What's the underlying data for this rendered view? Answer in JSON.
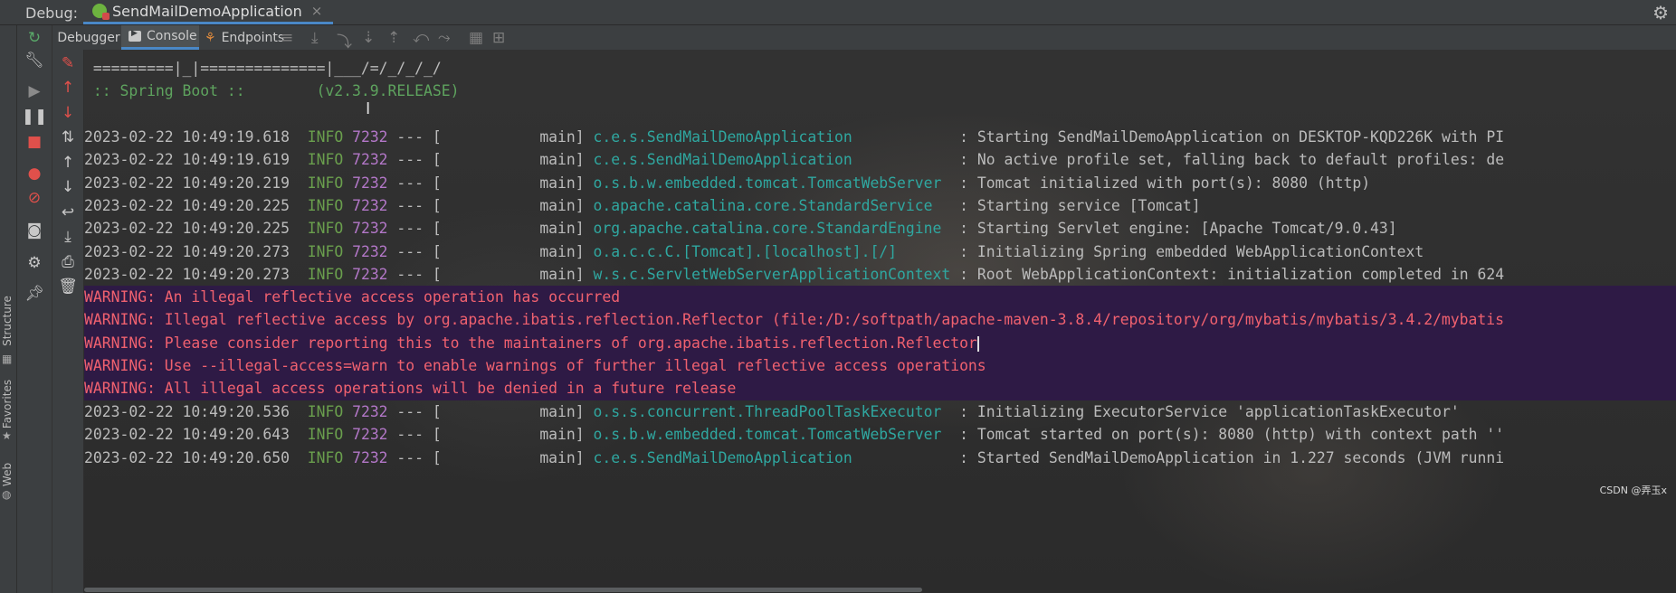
{
  "titlebar": {
    "label": "Debug:",
    "run_config": "SendMailDemoApplication",
    "close": "×"
  },
  "tabs": {
    "debugger": "Debugger",
    "console": "Console",
    "endpoints": "Endpoints"
  },
  "left_strip": {
    "structure": "Structure",
    "favorites": "Favorites",
    "web": "Web"
  },
  "console": {
    "banner_line1": " =========|_|==============|___/=/_/_/_/",
    "banner_line2": " :: Spring Boot ::        (v2.3.9.RELEASE)",
    "logs_top": [
      {
        "ts": "2023-02-22 10:49:19.618",
        "level": "INFO",
        "pid": "7232",
        "sep": " --- [           main] ",
        "logger": "c.e.s.SendMailDemoApplication           ",
        "msg": " : Starting SendMailDemoApplication on DESKTOP-KQD226K with PI"
      },
      {
        "ts": "2023-02-22 10:49:19.619",
        "level": "INFO",
        "pid": "7232",
        "sep": " --- [           main] ",
        "logger": "c.e.s.SendMailDemoApplication           ",
        "msg": " : No active profile set, falling back to default profiles: de"
      },
      {
        "ts": "2023-02-22 10:49:20.219",
        "level": "INFO",
        "pid": "7232",
        "sep": " --- [           main] ",
        "logger": "o.s.b.w.embedded.tomcat.TomcatWebServer ",
        "msg": " : Tomcat initialized with port(s): 8080 (http)"
      },
      {
        "ts": "2023-02-22 10:49:20.225",
        "level": "INFO",
        "pid": "7232",
        "sep": " --- [           main] ",
        "logger": "o.apache.catalina.core.StandardService  ",
        "msg": " : Starting service [Tomcat]"
      },
      {
        "ts": "2023-02-22 10:49:20.225",
        "level": "INFO",
        "pid": "7232",
        "sep": " --- [           main] ",
        "logger": "org.apache.catalina.core.StandardEngine ",
        "msg": " : Starting Servlet engine: [Apache Tomcat/9.0.43]"
      },
      {
        "ts": "2023-02-22 10:49:20.273",
        "level": "INFO",
        "pid": "7232",
        "sep": " --- [           main] ",
        "logger": "o.a.c.c.C.[Tomcat].[localhost].[/]      ",
        "msg": " : Initializing Spring embedded WebApplicationContext"
      },
      {
        "ts": "2023-02-22 10:49:20.273",
        "level": "INFO",
        "pid": "7232",
        "sep": " --- [           main] ",
        "logger": "w.s.c.ServletWebServerApplicationContext",
        "msg": " : Root WebApplicationContext: initialization completed in 624"
      }
    ],
    "warnings": [
      "WARNING: An illegal reflective access operation has occurred",
      "WARNING: Illegal reflective access by org.apache.ibatis.reflection.Reflector (file:/D:/softpath/apache-maven-3.8.4/repository/org/mybatis/mybatis/3.4.2/mybatis",
      "WARNING: Please consider reporting this to the maintainers of org.apache.ibatis.reflection.Reflector",
      "WARNING: Use --illegal-access=warn to enable warnings of further illegal reflective access operations",
      "WARNING: All illegal access operations will be denied in a future release"
    ],
    "logs_bottom": [
      {
        "ts": "2023-02-22 10:49:20.536",
        "level": "INFO",
        "pid": "7232",
        "sep": " --- [           main] ",
        "logger": "o.s.s.concurrent.ThreadPoolTaskExecutor ",
        "msg": " : Initializing ExecutorService 'applicationTaskExecutor'"
      },
      {
        "ts": "2023-02-22 10:49:20.643",
        "level": "INFO",
        "pid": "7232",
        "sep": " --- [           main] ",
        "logger": "o.s.b.w.embedded.tomcat.TomcatWebServer ",
        "msg": " : Tomcat started on port(s): 8080 (http) with context path ''"
      },
      {
        "ts": "2023-02-22 10:49:20.650",
        "level": "INFO",
        "pid": "7232",
        "sep": " --- [           main] ",
        "logger": "c.e.s.SendMailDemoApplication           ",
        "msg": " : Started SendMailDemoApplication in 1.227 seconds (JVM runni"
      }
    ]
  },
  "watermark": "CSDN @弄玉x",
  "colors": {
    "accent": "#4a88c7",
    "warning_bg": "#2e1a45",
    "warning_text": "#f0616f",
    "logger": "#2fa7a0",
    "pid": "#b377c8",
    "info": "#6a9f4d"
  },
  "icons": [
    "rerun-icon",
    "wrench-icon",
    "resume-icon",
    "pause-icon",
    "stop-icon",
    "view-breakpoints-icon",
    "mute-breakpoints-icon",
    "camera-icon",
    "settings-icon",
    "pin-icon",
    "clear-icon",
    "up-arrow-icon",
    "down-arrow-icon",
    "sort-icon",
    "scroll-to-end-icon",
    "soft-wrap-icon",
    "print-icon",
    "trash-icon",
    "gear-icon"
  ]
}
